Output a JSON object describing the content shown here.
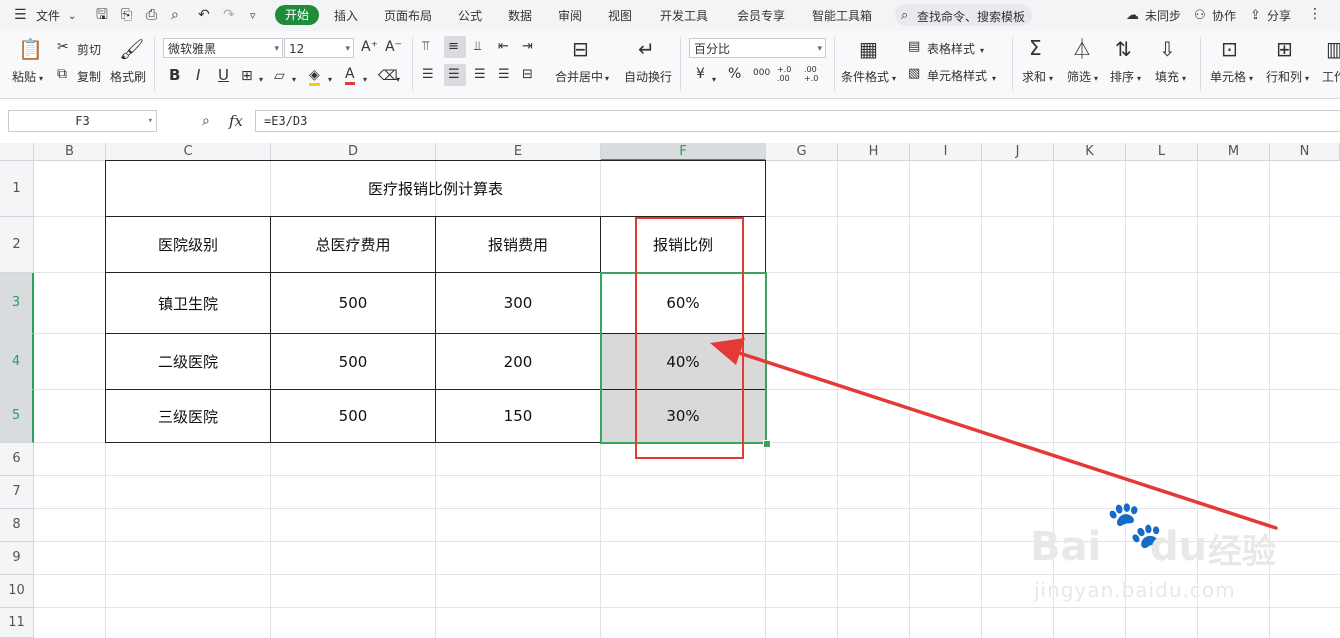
{
  "menubar": {
    "file": "文件",
    "tabs": [
      "开始",
      "插入",
      "页面布局",
      "公式",
      "数据",
      "审阅",
      "视图",
      "开发工具",
      "会员专享",
      "智能工具箱"
    ],
    "active_tab": "开始",
    "search_placeholder": "查找命令、搜索模板",
    "sync": "未同步",
    "collab": "协作",
    "share": "分享"
  },
  "ribbon": {
    "paste": "粘贴",
    "cut": "剪切",
    "copy": "复制",
    "format_painter": "格式刷",
    "font_name": "微软雅黑",
    "font_size": "12",
    "bold": "B",
    "italic": "I",
    "underline": "U",
    "merge_center": "合并居中",
    "wrap_text": "自动换行",
    "number_format": "百分比",
    "currency": "¥",
    "percent": "%",
    "thousands": "000",
    "inc_decimal": "+.0 .00",
    "dec_decimal": ".00 +.0",
    "cond_format": "条件格式",
    "table_style": "表格样式",
    "cell_style": "单元格样式",
    "sum": "求和",
    "filter": "筛选",
    "sort": "排序",
    "fill": "填充",
    "cell": "单元格",
    "row_col": "行和列",
    "worksheet": "工作"
  },
  "formula_bar": {
    "name_box": "F3",
    "fx": "fx",
    "formula": "=E3/D3"
  },
  "columns": [
    "B",
    "C",
    "D",
    "E",
    "F",
    "G",
    "H",
    "I",
    "J",
    "K",
    "L",
    "M",
    "N"
  ],
  "rows": [
    "1",
    "2",
    "3",
    "4",
    "5",
    "6",
    "7",
    "8",
    "9",
    "10",
    "11"
  ],
  "table": {
    "title": "医疗报销比例计算表",
    "headers": [
      "医院级别",
      "总医疗费用",
      "报销费用",
      "报销比例"
    ],
    "rows": [
      [
        "镇卫生院",
        "500",
        "300",
        "60%"
      ],
      [
        "二级医院",
        "500",
        "200",
        "40%"
      ],
      [
        "三级医院",
        "500",
        "150",
        "30%"
      ]
    ]
  },
  "watermark": {
    "brand": "Bai",
    "brand2": "du",
    "cn": "经验",
    "url": "jingyan.baidu.com"
  },
  "colors": {
    "accent": "#1f8b3b",
    "selection": "#3ba55d",
    "annotation": "#e53935"
  }
}
